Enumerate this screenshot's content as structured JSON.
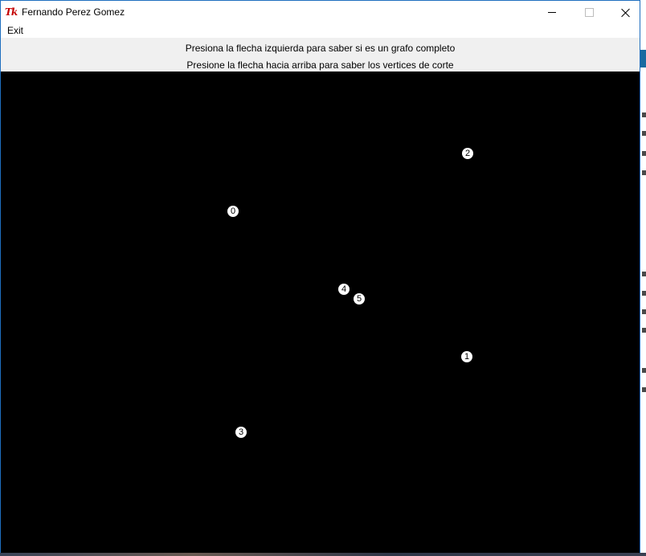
{
  "window": {
    "title": "Fernando Perez Gomez",
    "icon": "tk-feather-icon",
    "icon_text": "Tk"
  },
  "menu": {
    "items": [
      {
        "label": "Exit"
      }
    ]
  },
  "info": {
    "line1": "Presiona la flecha izquierda para saber si es un grafo completo",
    "line2": "Presione la flecha hacia arriba para saber los vertices de corte"
  },
  "canvas": {
    "background": "#000000",
    "node_color": "#ffffff",
    "nodes": [
      {
        "label": "0"
      },
      {
        "label": "1"
      },
      {
        "label": "2"
      },
      {
        "label": "3"
      },
      {
        "label": "4"
      },
      {
        "label": "5"
      }
    ]
  }
}
